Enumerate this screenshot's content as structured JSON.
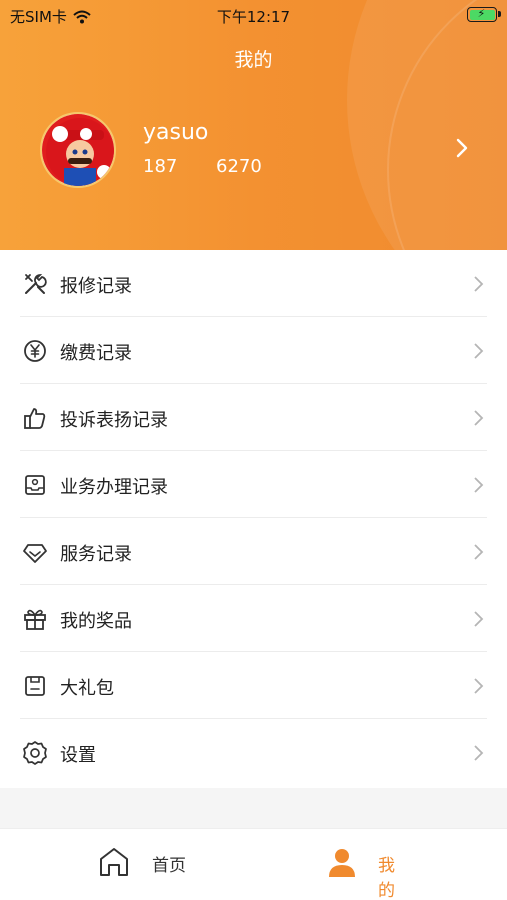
{
  "status_bar": {
    "carrier": "无SIM卡",
    "time": "下午12:17"
  },
  "header": {
    "title": "我的"
  },
  "profile": {
    "username": "yasuo",
    "stat1": "187",
    "stat2": "6270"
  },
  "menu": {
    "items": [
      {
        "label": "报修记录",
        "icon": "wrench-icon"
      },
      {
        "label": "缴费记录",
        "icon": "yuan-coin-icon"
      },
      {
        "label": "投诉表扬记录",
        "icon": "thumbs-up-icon"
      },
      {
        "label": "业务办理记录",
        "icon": "tray-icon"
      },
      {
        "label": "服务记录",
        "icon": "diamond-icon"
      },
      {
        "label": "我的奖品",
        "icon": "gift-icon"
      },
      {
        "label": "大礼包",
        "icon": "package-icon"
      },
      {
        "label": "设置",
        "icon": "gear-icon"
      }
    ]
  },
  "tabbar": {
    "home_label": "首页",
    "mine_label": "我的",
    "active_color": "#f08a2e"
  },
  "colors": {
    "header_start": "#f7a23a",
    "header_end": "#f08a2e"
  }
}
